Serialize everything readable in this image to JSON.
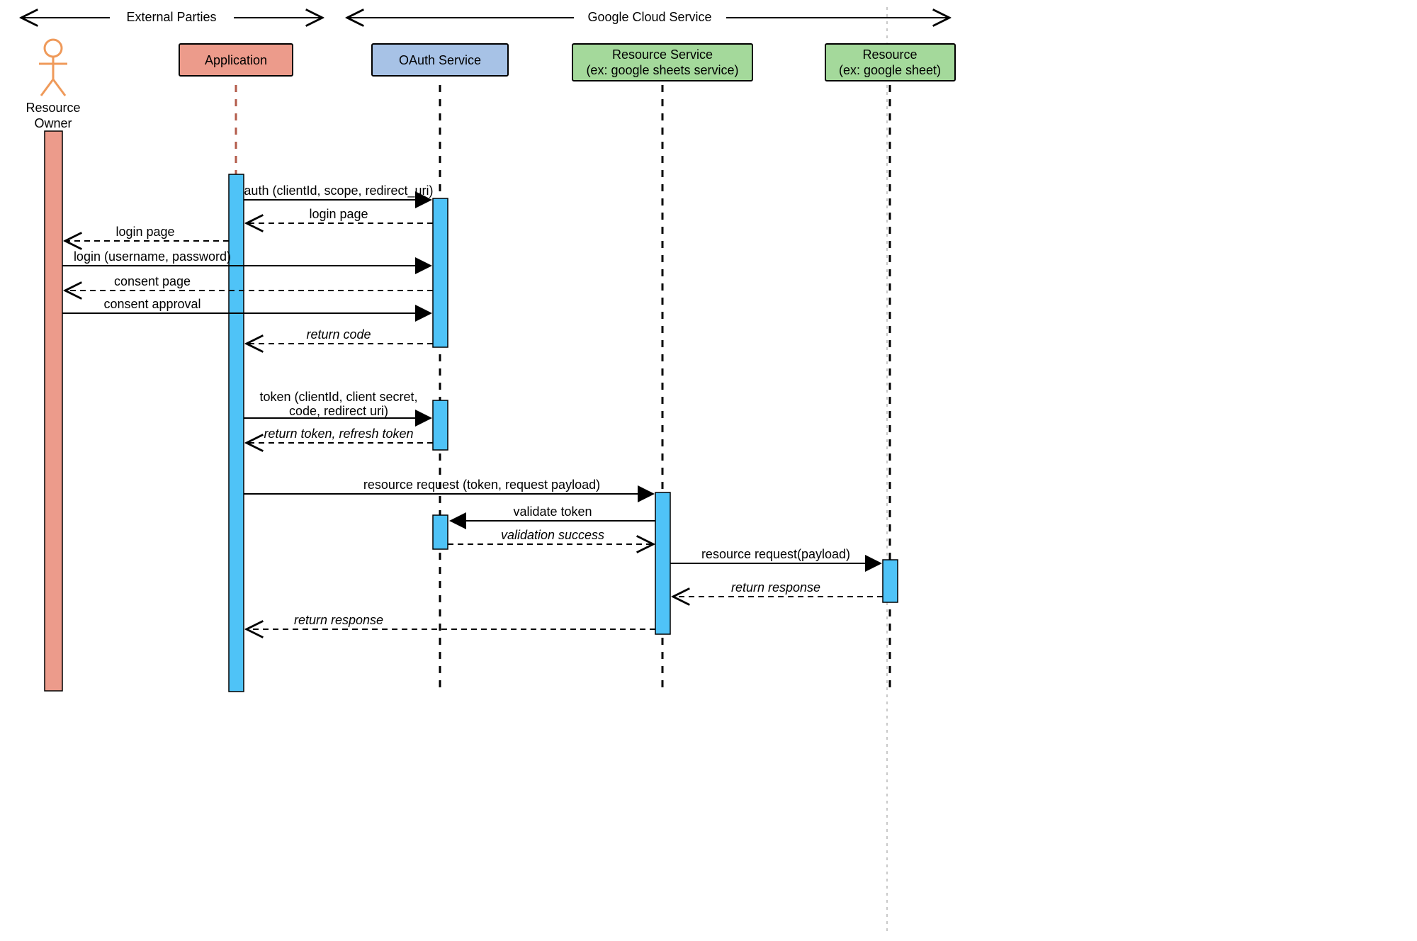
{
  "topGroups": {
    "left": "External Parties",
    "right": "Google Cloud Service"
  },
  "actors": {
    "owner": {
      "label1": "Resource",
      "label2": "Owner"
    },
    "application": {
      "label": "Application"
    },
    "oauth": {
      "label": "OAuth Service"
    },
    "resourceService": {
      "label1": "Resource Service",
      "label2": "(ex: google sheets service)"
    },
    "resource": {
      "label1": "Resource",
      "label2": "(ex: google sheet)"
    }
  },
  "messages": {
    "m1": "auth (clientId, scope, redirect_uri)",
    "m2": "login page",
    "m3": "login page",
    "m4": "login (username, password)",
    "m5": "consent page",
    "m6": "consent approval",
    "m7": "return code",
    "m8a": "token (clientId, client secret,",
    "m8b": "code, redirect uri)",
    "m9": "return token, refresh token",
    "m10": "resource request (token, request payload)",
    "m11": "validate token",
    "m12": "validation success",
    "m13": "resource request(payload)",
    "m14": "return response",
    "m15": "return response"
  },
  "colors": {
    "appBox": "#ec9b8b",
    "oauthBox": "#a7c2e6",
    "greenBox": "#a4d99b",
    "activation": "#4fc3f7",
    "ownerBar": "#ec9b8b",
    "actorFigure": "#ef9a5a"
  }
}
